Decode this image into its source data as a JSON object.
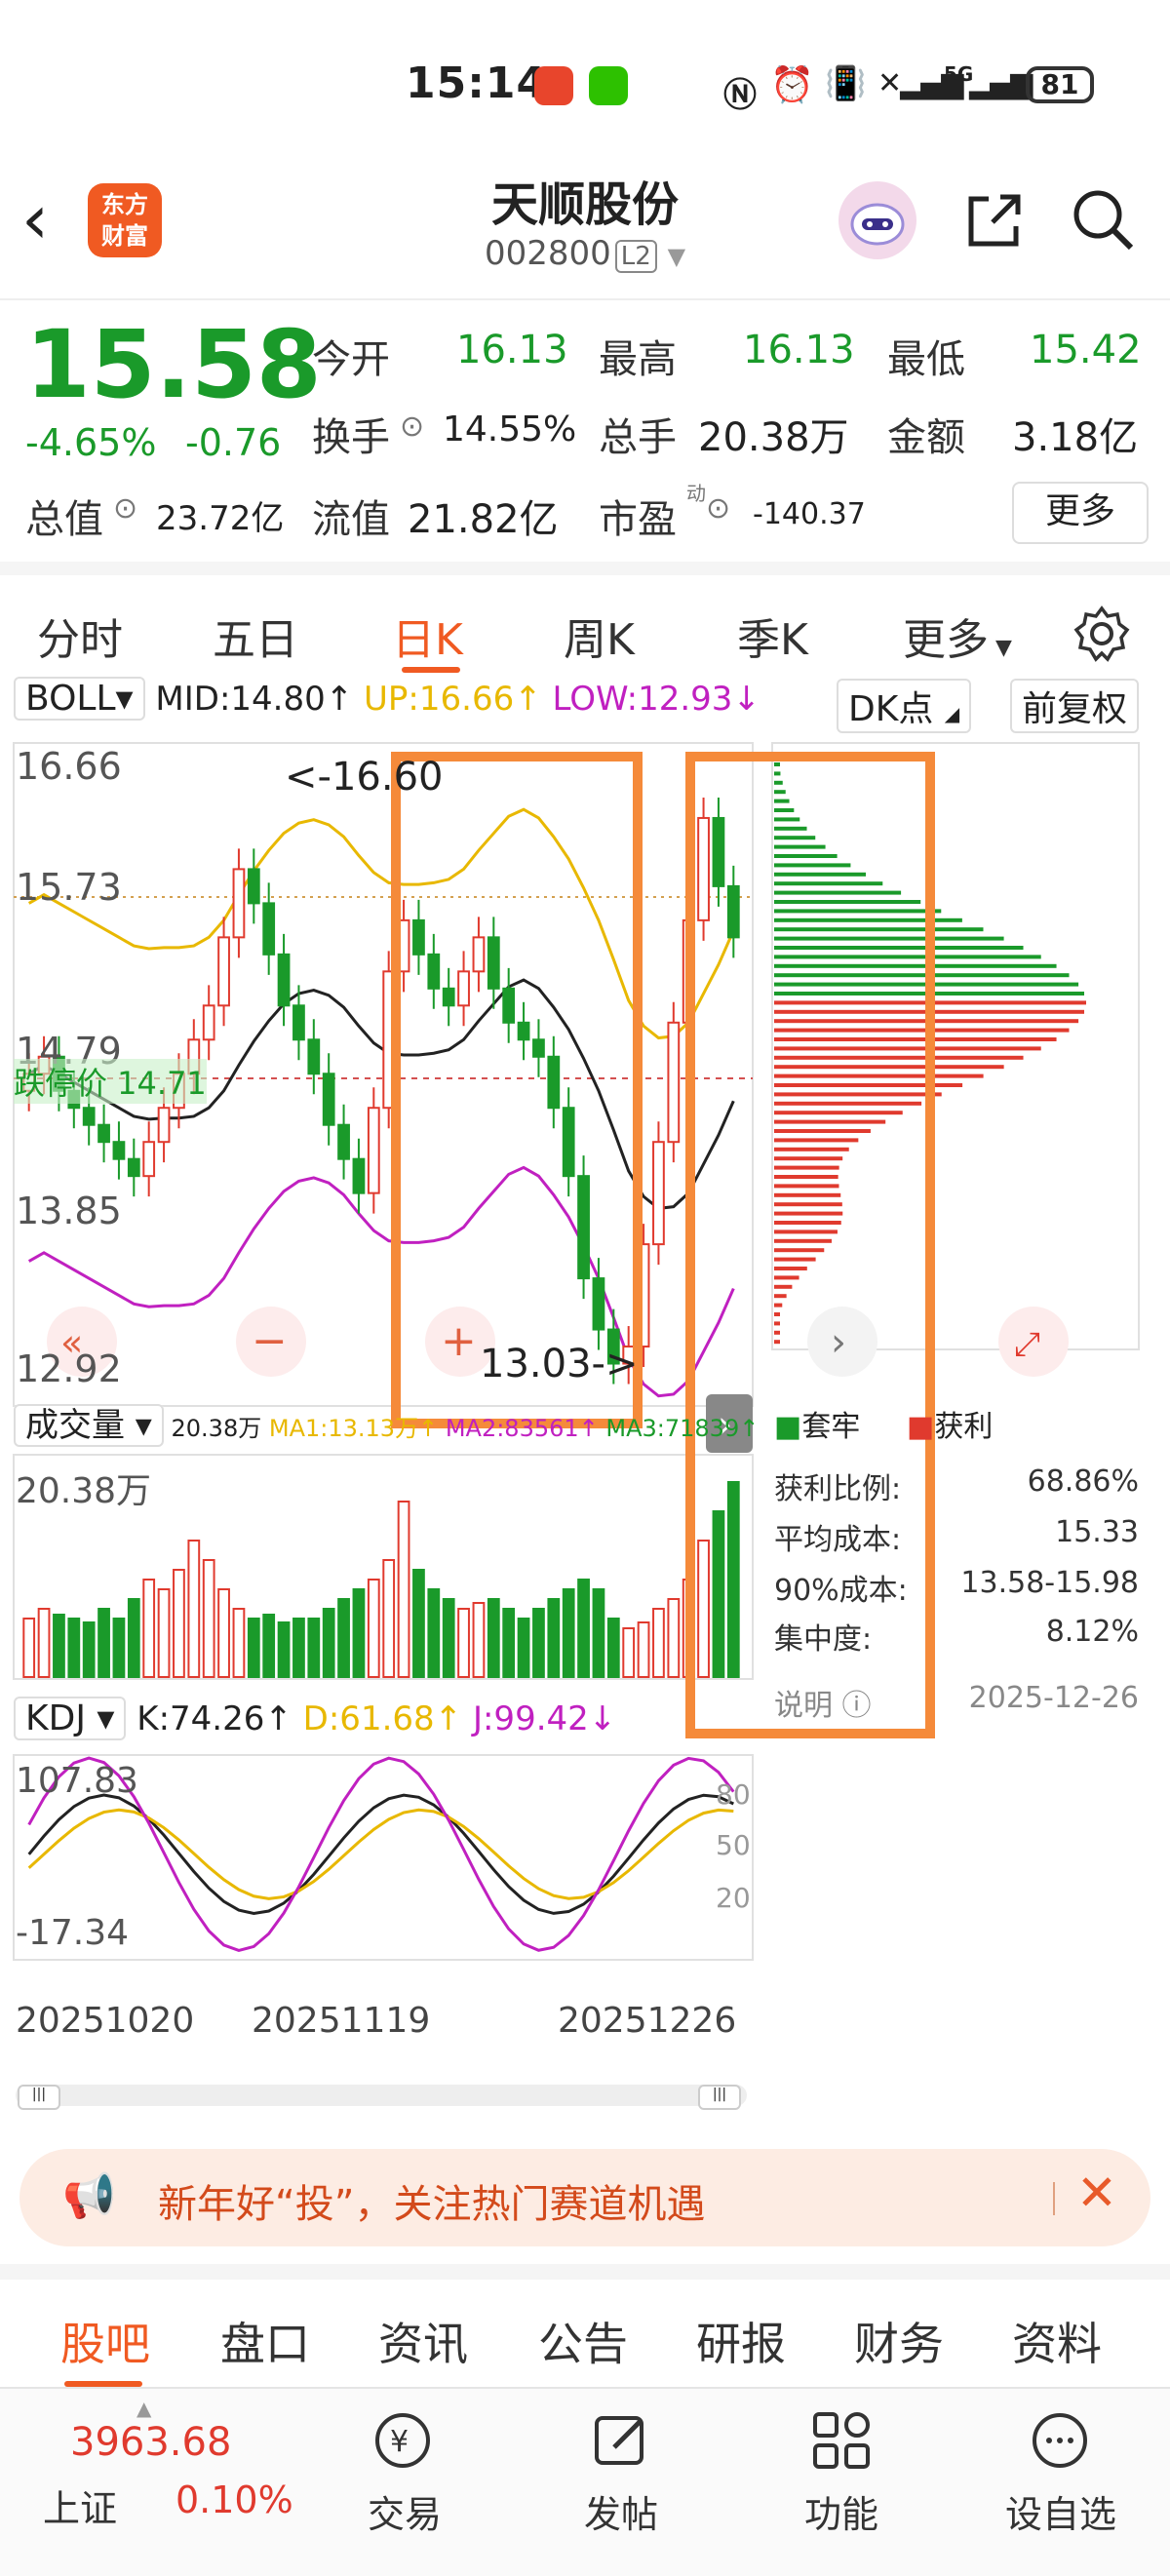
{
  "status_bar": {
    "time": "15:14",
    "network": "5G",
    "battery": "81"
  },
  "header": {
    "logo_text": "东方财富",
    "title": "天顺股份",
    "code": "002800",
    "level": "L2"
  },
  "quote": {
    "price": "15.58",
    "change_pct": "-4.65%",
    "change_amt": "-0.76",
    "open_label": "今开",
    "open": "16.13",
    "high_label": "最高",
    "high": "16.13",
    "low_label": "最低",
    "low": "15.42",
    "turnover_label": "换手",
    "turnover": "14.55%",
    "volume_label": "总手",
    "volume": "20.38万",
    "amount_label": "金额",
    "amount": "3.18亿",
    "mktcap_label": "总值",
    "mktcap": "23.72亿",
    "float_label": "流值",
    "float": "21.82亿",
    "pe_label": "市盈",
    "pe_sup": "动",
    "pe": "-140.37",
    "more_label": "更多"
  },
  "ktabs": [
    "分时",
    "五日",
    "日K",
    "周K",
    "季K",
    "更多"
  ],
  "ktab_active": "日K",
  "boll": {
    "name": "BOLL",
    "mid": "MID:14.80↑",
    "up": "UP:16.66↑",
    "low": "LOW:12.93↓",
    "dk_label": "DK点",
    "fq_label": "前复权"
  },
  "price_axis": {
    "top": "16.66",
    "mid1": "15.73",
    "mid2": "14.79",
    "mid3": "13.85",
    "bottom": "12.92"
  },
  "annotations": {
    "high_mark": "<-16.60",
    "low_mark": "13.03->",
    "limit_label": "跌停价 14.71"
  },
  "volume": {
    "name": "成交量",
    "value": "20.38万",
    "ma1": "MA1:13.13万↑",
    "ma2": "MA2:83561↑",
    "ma3": "MA3:71839↑",
    "axis_top": "20.38万"
  },
  "kdj": {
    "name": "KDJ",
    "k": "K:74.26↑",
    "d": "D:61.68↑",
    "j": "J:99.42↓",
    "axis_top": "107.83",
    "axis_bottom": "-17.34",
    "levels": [
      "80",
      "50",
      "20"
    ]
  },
  "dates": [
    "20251020",
    "20251119",
    "20251226"
  ],
  "chips": {
    "legend_trapped": "套牢",
    "legend_profit": "获利",
    "profit_ratio_label": "获利比例:",
    "profit_ratio": "68.86%",
    "avg_cost_label": "平均成本:",
    "avg_cost": "15.33",
    "cost90_label": "90%成本:",
    "cost90": "13.58-15.98",
    "concentration_label": "集中度:",
    "concentration": "8.12%",
    "explain_label": "说明",
    "date": "2025-12-26"
  },
  "banner": {
    "text": "新年好“投”，关注热门赛道机遇"
  },
  "btabs": [
    "股吧",
    "盘口",
    "资讯",
    "公告",
    "研报",
    "财务",
    "资料"
  ],
  "nav": {
    "index_value": "3963.68",
    "index_name": "上证",
    "index_change": "0.10%",
    "items": [
      "交易",
      "发帖",
      "功能",
      "设自选"
    ]
  },
  "colors": {
    "brand": "#f05a22",
    "up": "#e03a2e",
    "down": "#1a9a2a",
    "boll_up": "#e8b800",
    "boll_low": "#c020c0",
    "highlight": "#f58a3a"
  }
}
